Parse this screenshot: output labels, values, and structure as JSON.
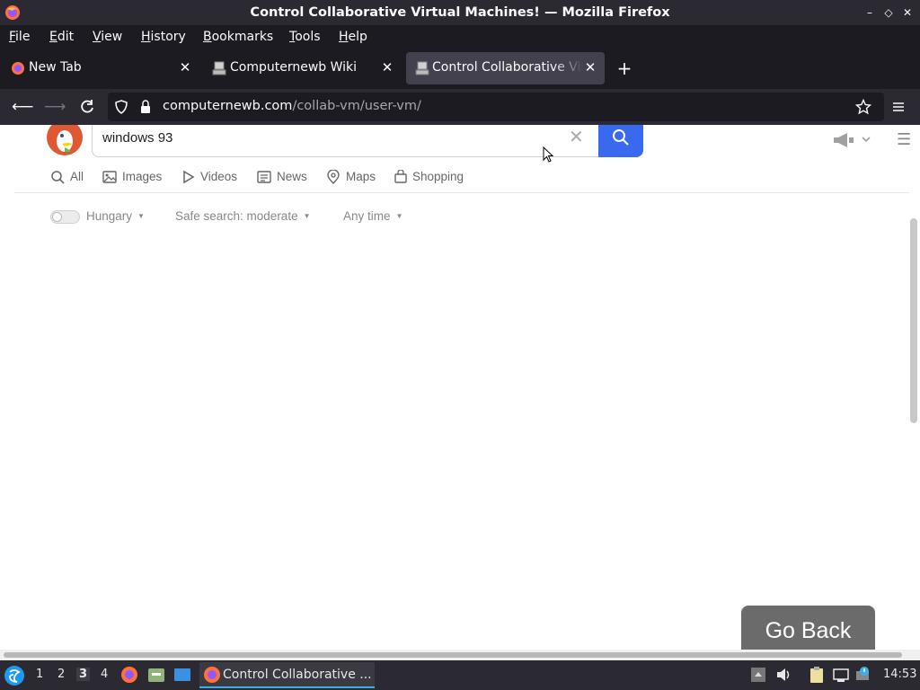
{
  "window": {
    "title": "Control Collaborative Virtual Machines! — Mozilla Firefox",
    "controls": {
      "minimize": "–",
      "restore": "◇",
      "close": "✕"
    }
  },
  "menubar": {
    "items": [
      {
        "label": "File",
        "accel": "F",
        "rest": "ile"
      },
      {
        "label": "Edit",
        "accel": "E",
        "rest": "dit"
      },
      {
        "label": "View",
        "accel": "V",
        "rest": "iew"
      },
      {
        "label": "History",
        "accel": "H",
        "rest": "istory"
      },
      {
        "label": "Bookmarks",
        "accel": "B",
        "rest": "ookmarks"
      },
      {
        "label": "Tools",
        "accel": "T",
        "rest": "ools"
      },
      {
        "label": "Help",
        "accel": "H",
        "rest": "elp"
      }
    ]
  },
  "tabs": [
    {
      "label": "New Tab",
      "icon": "firefox-icon",
      "active": false
    },
    {
      "label": "Computernewb Wiki",
      "icon": "computernewb-icon",
      "active": false
    },
    {
      "label": "Control Collaborative Virt",
      "icon": "computernewb-icon",
      "active": true
    }
  ],
  "navbar": {
    "url_domain": "computernewb.com",
    "url_path": "/collab-vm/user-vm/"
  },
  "search": {
    "query": "windows 93",
    "verticals": [
      "All",
      "Images",
      "Videos",
      "News",
      "Maps",
      "Shopping"
    ],
    "filters": {
      "region": "Hungary",
      "safe_search": "Safe search: moderate",
      "time": "Any time"
    }
  },
  "overlay": {
    "go_back_label": "Go Back"
  },
  "taskbar": {
    "workspaces": [
      "1",
      "2",
      "3",
      "4"
    ],
    "active_workspace": "3",
    "task_label": "Control Collaborative ...",
    "clock": "14:53"
  },
  "colors": {
    "ddg_orange": "#de5833",
    "search_blue": "#3969ef",
    "chrome_dark": "#1c1b22",
    "chrome_mid": "#2b2a33",
    "tab_active": "#42414d"
  }
}
